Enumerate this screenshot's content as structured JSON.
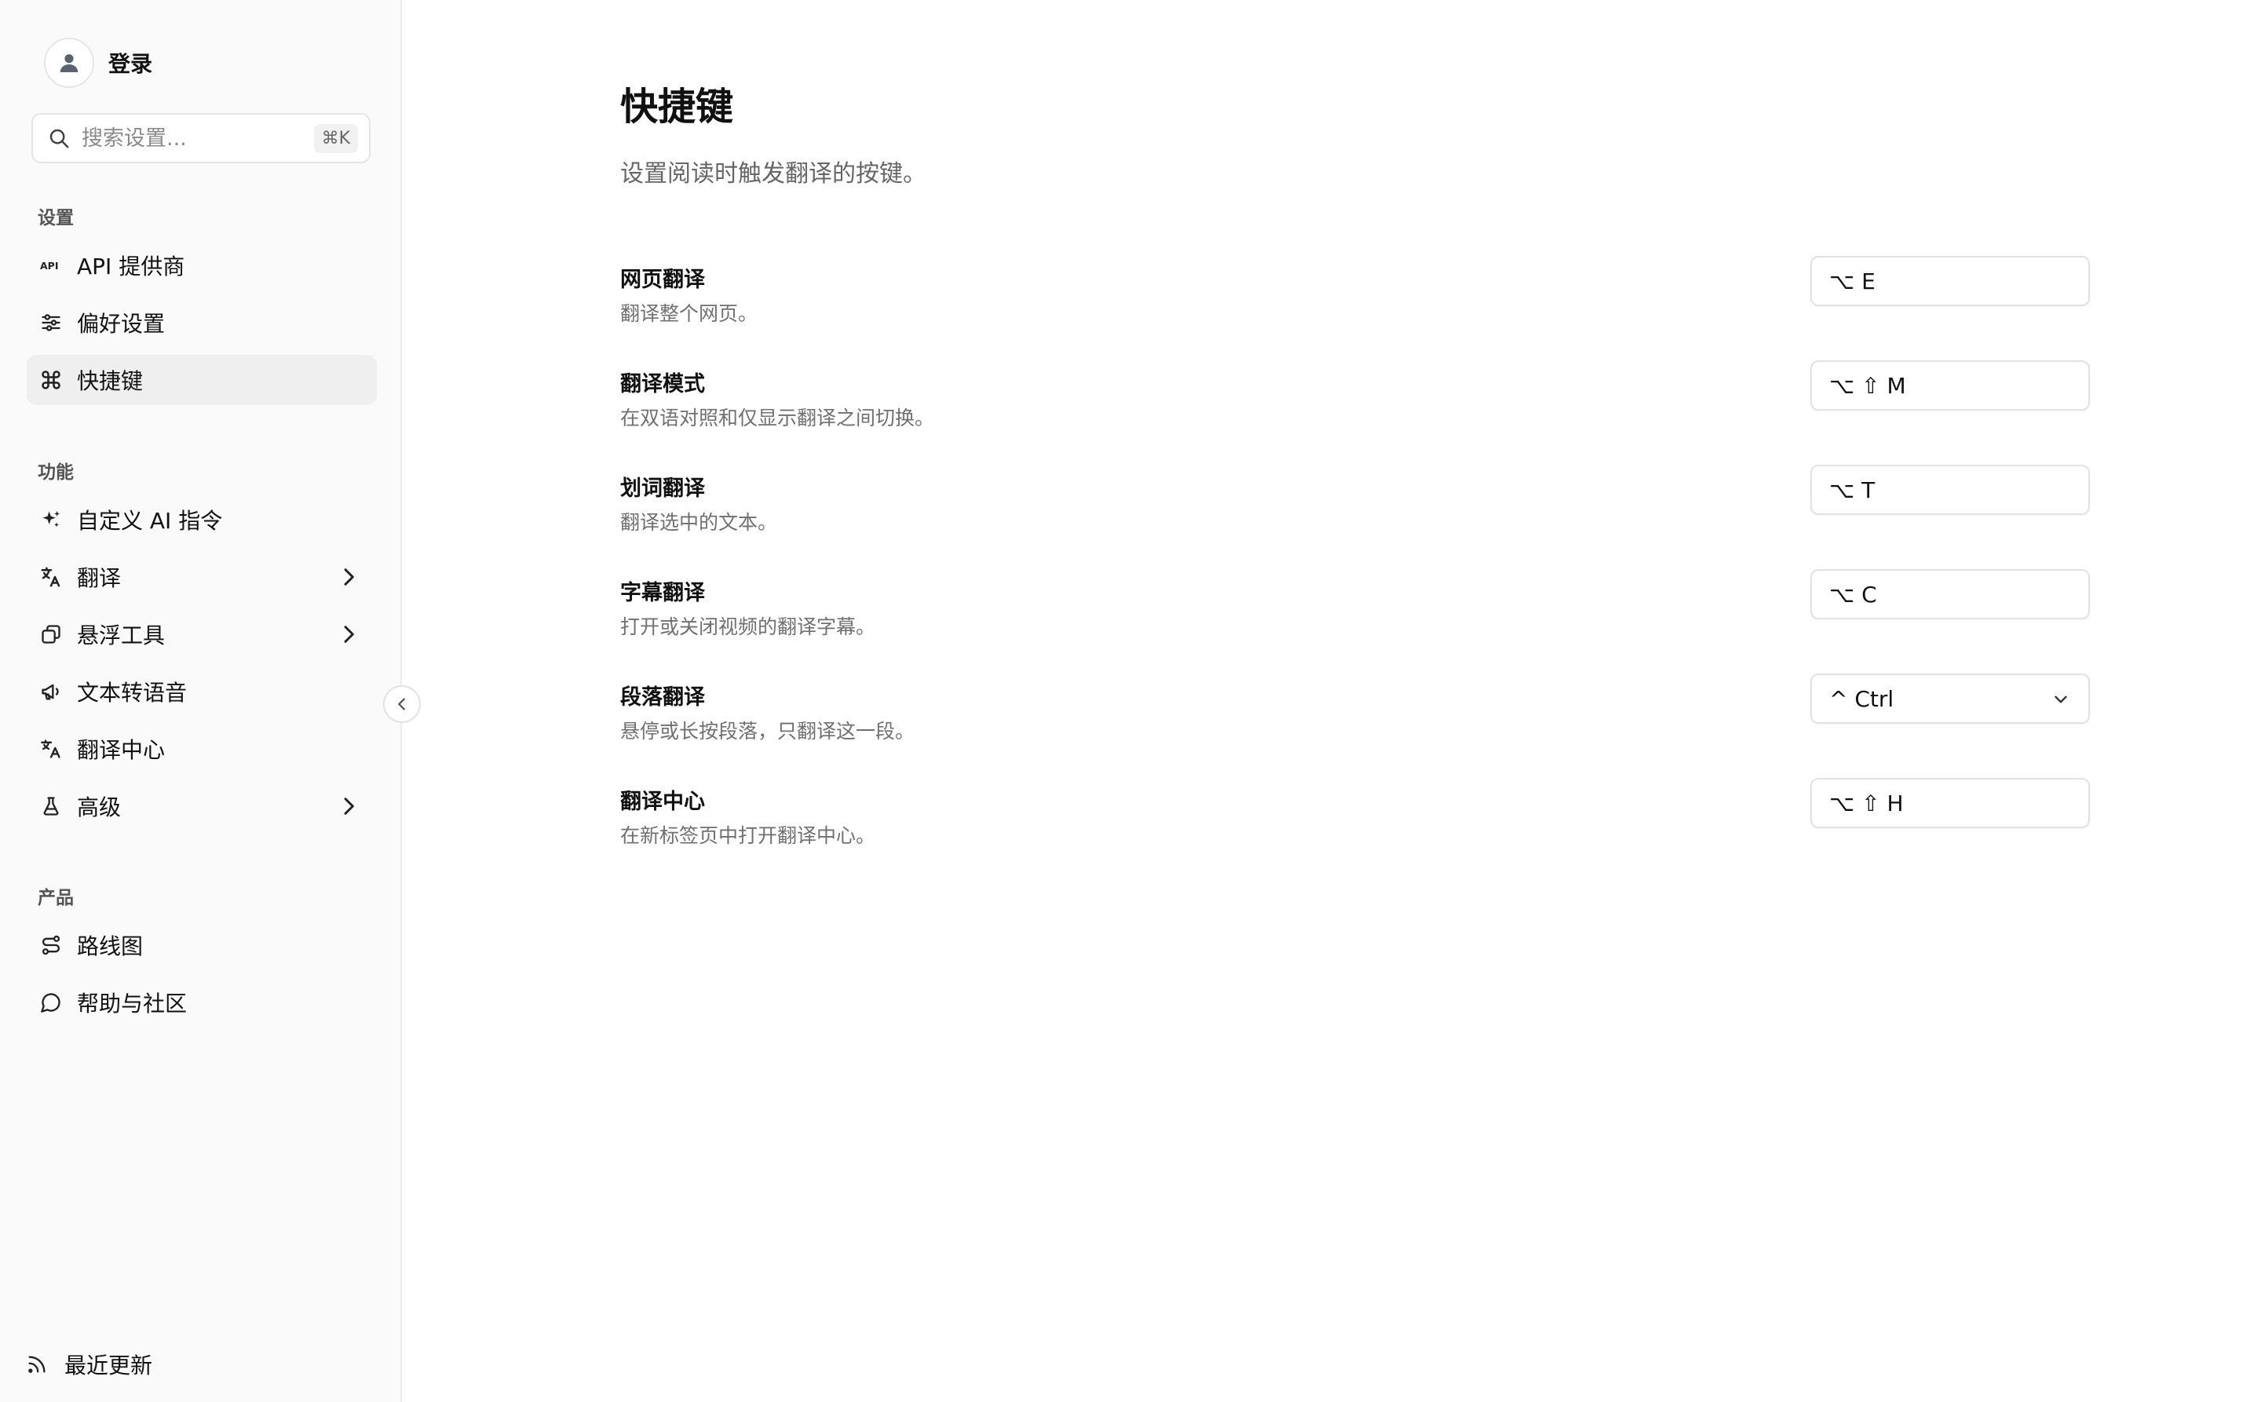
{
  "sidebar": {
    "login_label": "登录",
    "search": {
      "placeholder": "搜索设置...",
      "shortcut": "⌘K"
    },
    "sections": {
      "settings": "设置",
      "features": "功能",
      "product": "产品"
    },
    "items": {
      "api": {
        "label": "API 提供商",
        "icon": "api-icon"
      },
      "preferences": {
        "label": "偏好设置",
        "icon": "sliders-icon"
      },
      "shortcuts": {
        "label": "快捷键",
        "icon": "command-icon",
        "active": true
      },
      "custom_ai": {
        "label": "自定义 AI 指令",
        "icon": "sparkles-icon"
      },
      "translate": {
        "label": "翻译",
        "icon": "translate-icon",
        "expandable": true
      },
      "floating_tools": {
        "label": "悬浮工具",
        "icon": "layers-icon",
        "expandable": true
      },
      "tts": {
        "label": "文本转语音",
        "icon": "megaphone-icon"
      },
      "translation_hub": {
        "label": "翻译中心",
        "icon": "language-icon"
      },
      "advanced": {
        "label": "高级",
        "icon": "flask-icon",
        "expandable": true
      },
      "roadmap": {
        "label": "路线图",
        "icon": "route-icon"
      },
      "help": {
        "label": "帮助与社区",
        "icon": "message-circle-icon"
      }
    },
    "recent_updates": {
      "label": "最近更新",
      "icon": "rss-icon"
    }
  },
  "main": {
    "title": "快捷键",
    "description": "设置阅读时触发翻译的按键。",
    "shortcuts": [
      {
        "title": "网页翻译",
        "desc": "翻译整个网页。",
        "keys": "⌥ E"
      },
      {
        "title": "翻译模式",
        "desc": "在双语对照和仅显示翻译之间切换。",
        "keys": "⌥ ⇧ M"
      },
      {
        "title": "划词翻译",
        "desc": "翻译选中的文本。",
        "keys": "⌥ T"
      },
      {
        "title": "字幕翻译",
        "desc": "打开或关闭视频的翻译字幕。",
        "keys": "⌥ C"
      },
      {
        "title": "段落翻译",
        "desc": "悬停或长按段落，只翻译这一段。",
        "keys": "^ Ctrl",
        "dropdown": true
      },
      {
        "title": "翻译中心",
        "desc": "在新标签页中打开翻译中心。",
        "keys": "⌥ ⇧ H"
      }
    ]
  }
}
